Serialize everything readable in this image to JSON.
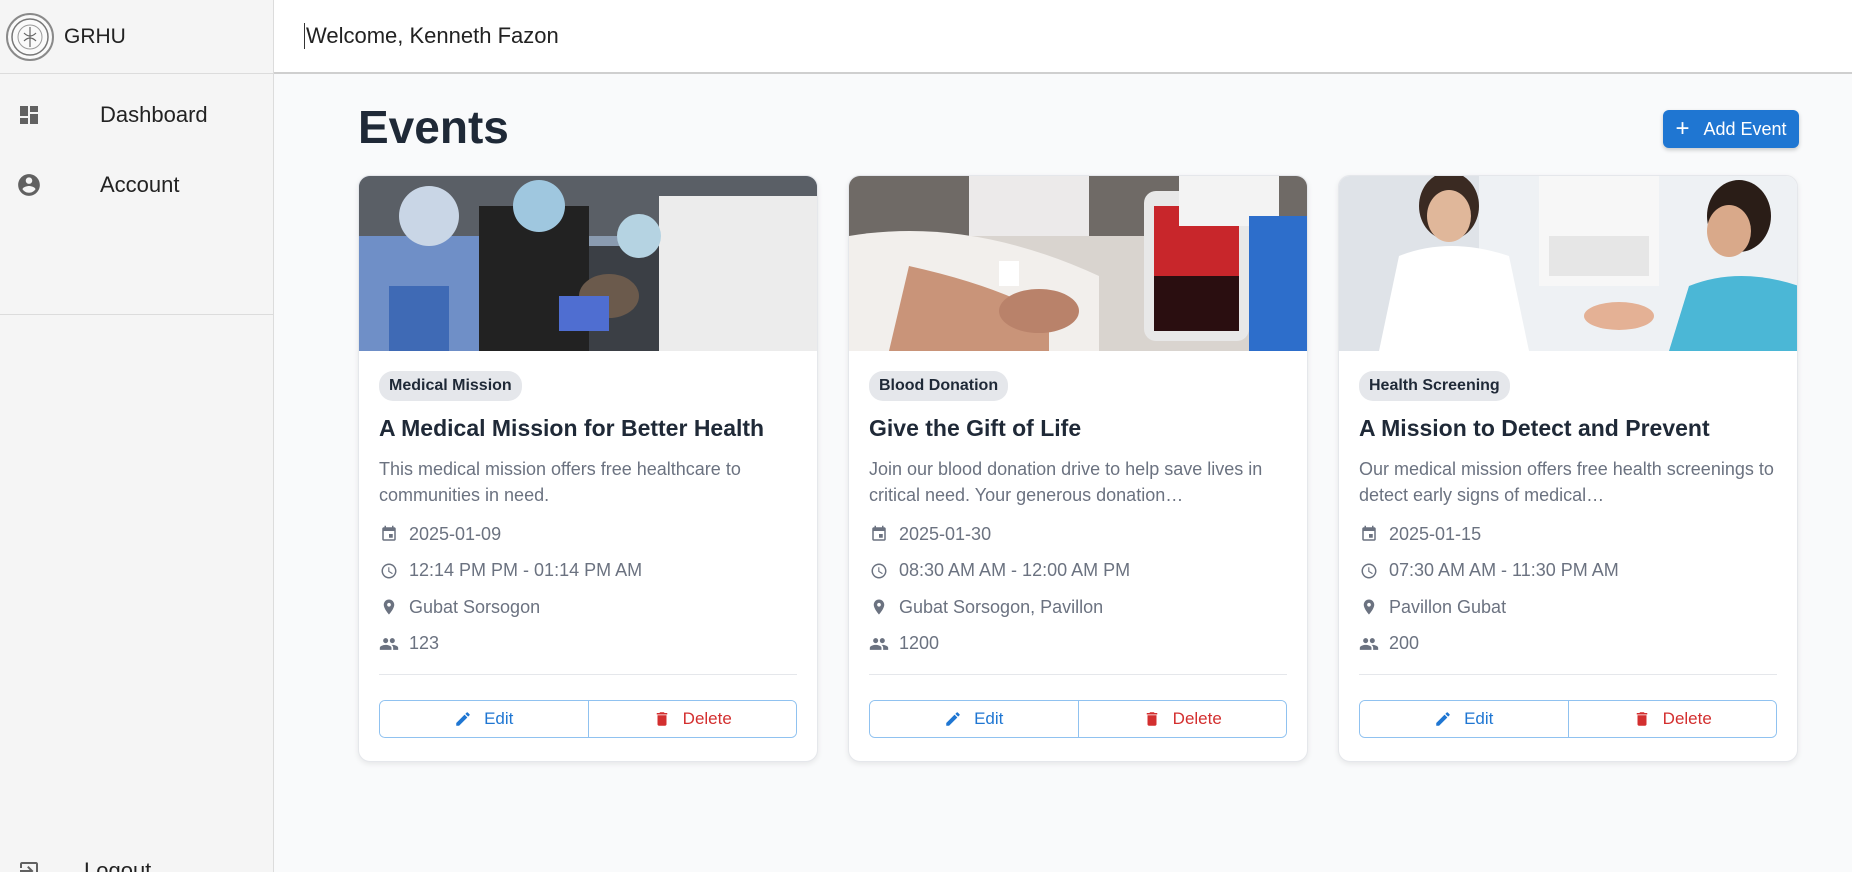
{
  "app": {
    "brand": "GRHU"
  },
  "sidebar": {
    "items": [
      {
        "label": "Dashboard",
        "icon": "dashboard-icon"
      },
      {
        "label": "Account",
        "icon": "account-circle-icon"
      }
    ],
    "logout_label": "Logout"
  },
  "topbar": {
    "welcome": "Welcome, Kenneth Fazon"
  },
  "main": {
    "title": "Events",
    "add_button_label": "Add Event"
  },
  "events": [
    {
      "tag": "Medical Mission",
      "title": "A Medical Mission for Better Health",
      "description": "This medical mission offers free healthcare to communities in need.",
      "date": "2025-01-09",
      "time": "12:14 PM PM - 01:14 PM AM",
      "location": "Gubat Sorsogon",
      "attendees": "123",
      "edit_label": "Edit",
      "delete_label": "Delete"
    },
    {
      "tag": "Blood Donation",
      "title": "Give the Gift of Life",
      "description": "Join our blood donation drive to help save lives in critical need. Your generous donation…",
      "date": "2025-01-30",
      "time": "08:30 AM AM - 12:00 AM PM",
      "location": "Gubat Sorsogon, Pavillon",
      "attendees": "1200",
      "edit_label": "Edit",
      "delete_label": "Delete"
    },
    {
      "tag": "Health Screening",
      "title": "A Mission to Detect and Prevent",
      "description": "Our medical mission offers free health screenings to detect early signs of medical…",
      "date": "2025-01-15",
      "time": "07:30 AM AM - 11:30 PM AM",
      "location": "Pavillon Gubat",
      "attendees": "200",
      "edit_label": "Edit",
      "delete_label": "Delete"
    }
  ],
  "colors": {
    "primary": "#1f76d2",
    "danger": "#d32f2f",
    "text_muted": "#6b7280"
  }
}
